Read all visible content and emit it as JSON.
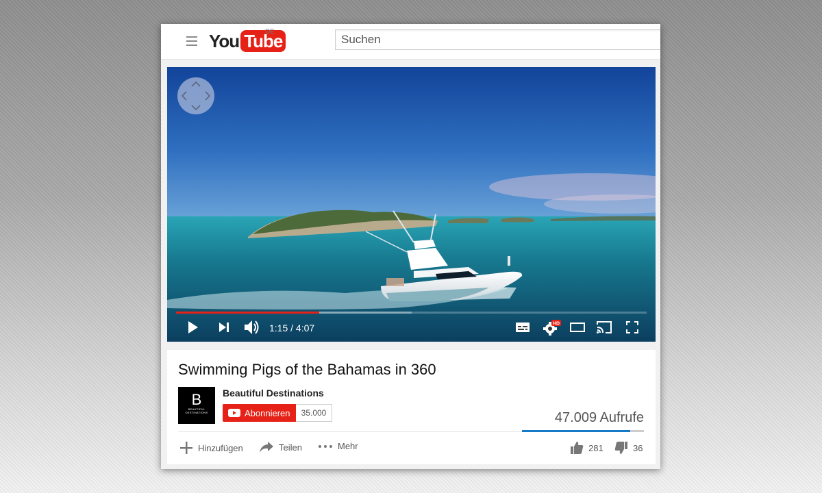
{
  "header": {
    "logo_you": "You",
    "logo_tube": "Tube",
    "region": "DE",
    "search_placeholder": "Suchen"
  },
  "player": {
    "time_current": "1:15",
    "time_total": "4:07",
    "time_display": "1:15 / 4:07",
    "played_fraction": 0.304,
    "buffered_fraction": 0.5,
    "hd_badge": "HD"
  },
  "video": {
    "title": "Swimming Pigs of the Bahamas in 360",
    "channel_name": "Beautiful Destinations",
    "avatar_letter": "B",
    "avatar_text": "BEAUTIFUL DESTINATIONS",
    "subscribe_label": "Abonnieren",
    "subscriber_count": "35.000",
    "views": "47.009 Aufrufe",
    "like_ratio": 0.89
  },
  "actions": {
    "add_label": "Hinzufügen",
    "share_label": "Teilen",
    "more_label": "Mehr",
    "likes": "281",
    "dislikes": "36"
  },
  "colors": {
    "brand_red": "#e62117",
    "accent_blue": "#167ac6"
  }
}
